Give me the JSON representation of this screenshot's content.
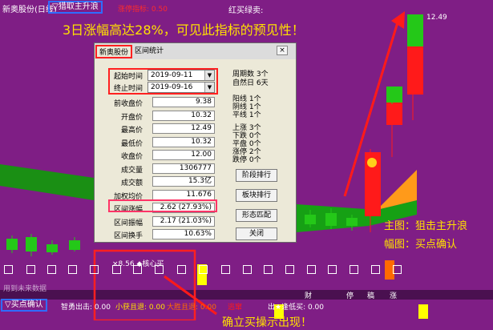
{
  "header": {
    "stock_title": "新奥股份(日线)",
    "indicator_name": "▽猎取主升浪",
    "limit_up_label": "涨停指标: 0.50",
    "red_light_buy_label": "红买绿卖:",
    "price_tag": "12.49"
  },
  "annotations": {
    "headline": "3日涨幅高达28%，可见此指标的预见性！",
    "main_chart": "主图：狙击主升浪",
    "sub_chart": "幅图：买点确认",
    "bottom_caption": "确立买操示出现！",
    "no_data_text": "用到未来数据",
    "heart_mark": "×8.56  ◆核心买"
  },
  "colors": {
    "background": "#7f1e85",
    "highlight_yellow": "#ffe000",
    "up_candle": "#ff1a1a",
    "down_candle": "#24c818",
    "dialog_bg": "#ece9d8",
    "annotation_red": "#ff2020",
    "annotation_blue": "#2f6cff"
  },
  "dialog": {
    "tab_stock": "新奥股份",
    "tab_interval": "区间统计",
    "close_glyph": "×",
    "start_time_label": "起始时间",
    "start_time_value": "2019-09-11",
    "end_time_label": "终止时间",
    "end_time_value": "2019-09-16",
    "weeks_text": "周期数  3个",
    "natural_days_text": "自然日  6天",
    "fields": [
      {
        "label": "前收盘价",
        "value": "9.38"
      },
      {
        "label": "开盘价",
        "value": "10.32"
      },
      {
        "label": "最高价",
        "value": "12.49"
      },
      {
        "label": "最低价",
        "value": "10.32"
      },
      {
        "label": "收盘价",
        "value": "12.00"
      },
      {
        "label": "成交量",
        "value": "1306777"
      },
      {
        "label": "成交额",
        "value": "15.3亿"
      },
      {
        "label": "加权均价",
        "value": "11.676"
      },
      {
        "label": "区间涨幅",
        "value": "2.62 (27.93%)"
      },
      {
        "label": "区间振幅",
        "value": "2.17 (21.03%)"
      },
      {
        "label": "区间换手",
        "value": "10.63%"
      }
    ],
    "candle_stats": [
      {
        "label": "阳线",
        "value": "1个"
      },
      {
        "label": "阴线",
        "value": "1个"
      },
      {
        "label": "平线",
        "value": "1个"
      }
    ],
    "move_stats": [
      {
        "label": "上涨",
        "value": "3个"
      },
      {
        "label": "下跌",
        "value": "0个"
      },
      {
        "label": "平盘",
        "value": "0个"
      },
      {
        "label": "涨停",
        "value": "2个"
      },
      {
        "label": "跌停",
        "value": "0个"
      }
    ],
    "buttons": {
      "stage_rank": "阶段排行",
      "sector_rank": "板块排行",
      "pattern_match": "形态匹配",
      "close": "关闭"
    }
  },
  "bottom": {
    "buy_confirm": "▽买点确认",
    "legend": [
      {
        "label": "智勇出击: 0.00",
        "color": "#ffffff"
      },
      {
        "label": "小获且退: 0.00",
        "color": "#ffe000"
      },
      {
        "label": "大胜且退: 0.00",
        "color": "#ff6a00"
      },
      {
        "label": "逃窜",
        "color": "#ff1a1a"
      },
      {
        "label": "出★逢低买: 0.00",
        "color": "#ffffff"
      }
    ],
    "axis_labels": [
      "财",
      "停",
      "稿",
      "涨"
    ]
  }
}
